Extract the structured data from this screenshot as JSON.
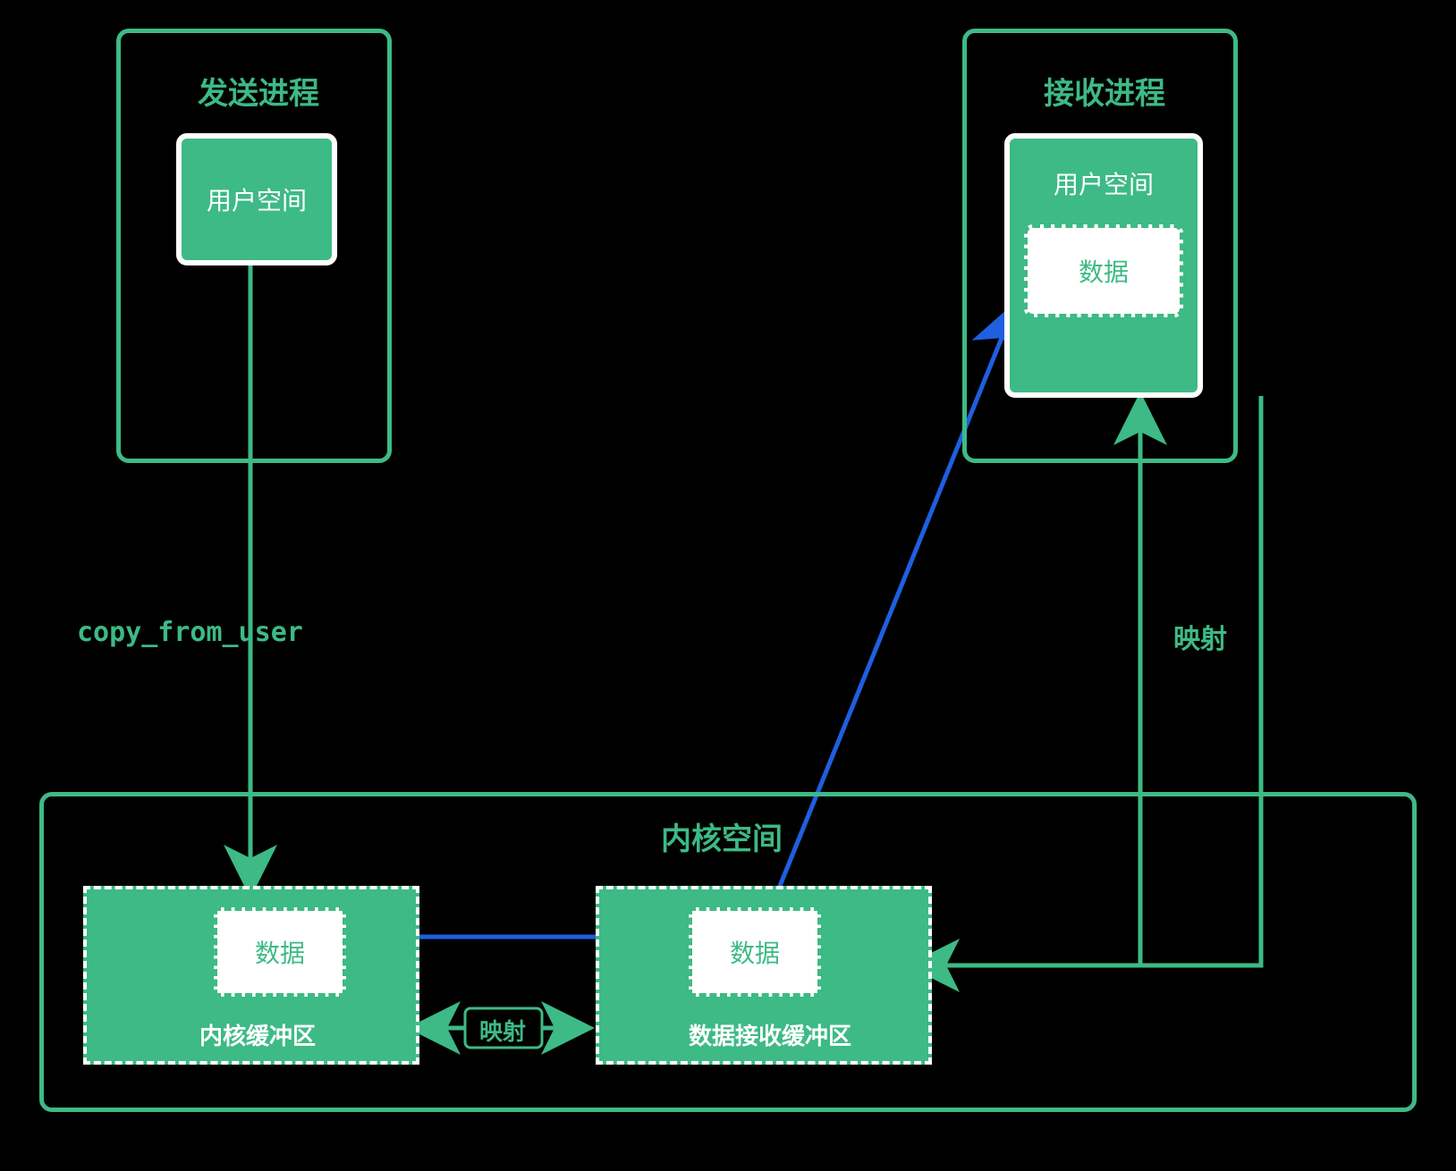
{
  "sender": {
    "title": "发送进程",
    "userSpace": "用户空间"
  },
  "receiver": {
    "title": "接收进程",
    "userSpace": "用户空间",
    "data": "数据"
  },
  "kernel": {
    "title": "内核空间",
    "bufA": {
      "label": "内核缓冲区",
      "data": "数据"
    },
    "bufB": {
      "label": "数据接收缓冲区",
      "data": "数据"
    }
  },
  "arrows": {
    "copyFromUser": "copy_from_user",
    "mapRight": "映射",
    "mapMid": "映射"
  },
  "colors": {
    "green": "#3dba85",
    "blue": "#1f5fe0",
    "white": "#ffffff",
    "bg": "#000000"
  }
}
